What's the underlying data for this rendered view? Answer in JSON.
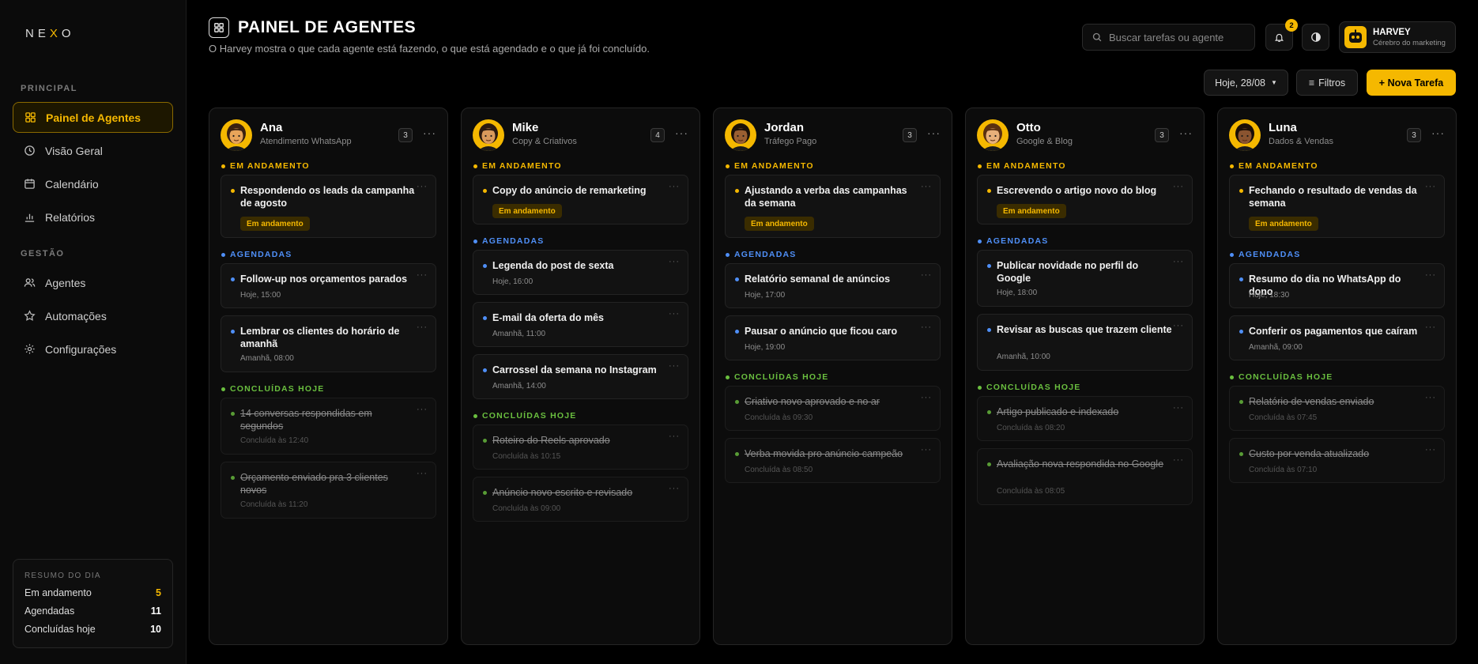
{
  "brand": {
    "logo": "NEXO"
  },
  "sidebar": {
    "sections": [
      {
        "title": "PRINCIPAL",
        "items": [
          {
            "label": "Painel de Agentes",
            "icon": "grid-icon",
            "active": true
          },
          {
            "label": "Visão Geral",
            "icon": "clock-icon"
          },
          {
            "label": "Calendário",
            "icon": "calendar-icon"
          },
          {
            "label": "Relatórios",
            "icon": "bar-chart-icon"
          }
        ]
      },
      {
        "title": "GESTÃO",
        "items": [
          {
            "label": "Agentes",
            "icon": "users-icon"
          },
          {
            "label": "Automações",
            "icon": "star-icon"
          },
          {
            "label": "Configurações",
            "icon": "gear-icon"
          }
        ]
      }
    ],
    "summary": {
      "title": "RESUMO DO DIA",
      "rows": [
        {
          "label": "Em andamento",
          "value": "5"
        },
        {
          "label": "Agendadas",
          "value": "11"
        },
        {
          "label": "Concluídas hoje",
          "value": "10"
        }
      ]
    }
  },
  "header": {
    "title": "PAINEL DE AGENTES",
    "subtitle": "O Harvey mostra o que cada agente está fazendo, o que está agendado e o que já foi concluído.",
    "search_placeholder": "Buscar tarefas ou agente",
    "notifications": "2",
    "profile": {
      "name": "HARVEY",
      "role": "Cérebro do marketing"
    },
    "date_filter": "Hoje, 28/08",
    "filters_label": "Filtros",
    "new_task_label": "+ Nova Tarefa"
  },
  "colors": {
    "accent": "#f5b800",
    "scheduled": "#4f8ff7",
    "done": "#6abf3f"
  },
  "columns": [
    {
      "name": "Ana",
      "role": "Atendimento WhatsApp",
      "count": "3",
      "skin": "#e8a45a",
      "hair": "#3a2010",
      "in_progress": {
        "label": "EM ANDAMENTO",
        "tasks": [
          {
            "title": "Respondendo os leads da campanha de agosto",
            "status": "Em andamento"
          }
        ]
      },
      "scheduled": {
        "label": "AGENDADAS",
        "tasks": [
          {
            "title": "Follow-up nos orçamentos parados",
            "time": "Hoje, 15:00"
          },
          {
            "title": "Lembrar os clientes do horário de amanhã",
            "time": "Amanhã, 08:00"
          }
        ]
      },
      "done": {
        "label": "CONCLUÍDAS HOJE",
        "tasks": [
          {
            "title": "14 conversas respondidas em segundos",
            "time": "Concluída às 12:40"
          },
          {
            "title": "Orçamento enviado pra 3 clientes novos",
            "time": "Concluída às 11:20"
          }
        ]
      }
    },
    {
      "name": "Mike",
      "role": "Copy & Criativos",
      "count": "4",
      "skin": "#d99a5c",
      "hair": "#2b1a10",
      "in_progress": {
        "label": "EM ANDAMENTO",
        "tasks": [
          {
            "title": "Copy do anúncio de remarketing",
            "status": "Em andamento"
          }
        ]
      },
      "scheduled": {
        "label": "AGENDADAS",
        "tasks": [
          {
            "title": "Legenda do post de sexta",
            "time": "Hoje, 16:00"
          },
          {
            "title": "E-mail da oferta do mês",
            "time": "Amanhã, 11:00"
          },
          {
            "title": "Carrossel da semana no Instagram",
            "time": "Amanhã, 14:00"
          }
        ]
      },
      "done": {
        "label": "CONCLUÍDAS HOJE",
        "tasks": [
          {
            "title": "Roteiro do Reels aprovado",
            "time": "Concluída às 10:15"
          },
          {
            "title": "Anúncio novo escrito e revisado",
            "time": "Concluída às 09:00"
          }
        ]
      }
    },
    {
      "name": "Jordan",
      "role": "Tráfego Pago",
      "count": "3",
      "skin": "#9a5f32",
      "hair": "#1a1008",
      "in_progress": {
        "label": "EM ANDAMENTO",
        "tasks": [
          {
            "title": "Ajustando a verba das campanhas da semana",
            "status": "Em andamento"
          }
        ]
      },
      "scheduled": {
        "label": "AGENDADAS",
        "tasks": [
          {
            "title": "Relatório semanal de anúncios",
            "time": "Hoje, 17:00"
          },
          {
            "title": "Pausar o anúncio que ficou caro",
            "time": "Hoje, 19:00"
          }
        ]
      },
      "done": {
        "label": "CONCLUÍDAS HOJE",
        "tasks": [
          {
            "title": "Criativo novo aprovado e no ar",
            "time": "Concluída às 09:30"
          },
          {
            "title": "Verba movida pro anúncio campeão",
            "time": "Concluída às 08:50"
          }
        ]
      }
    },
    {
      "name": "Otto",
      "role": "Google & Blog",
      "count": "3",
      "skin": "#e8b07a",
      "hair": "#5a3010",
      "in_progress": {
        "label": "EM ANDAMENTO",
        "tasks": [
          {
            "title": "Escrevendo o artigo novo do blog",
            "status": "Em andamento"
          }
        ]
      },
      "scheduled": {
        "label": "AGENDADAS",
        "tasks": [
          {
            "title": "Publicar novidade no perfil do Google",
            "time": "Hoje, 18:00"
          },
          {
            "title": "Revisar as buscas que trazem cliente",
            "time": "Amanhã, 10:00"
          }
        ]
      },
      "done": {
        "label": "CONCLUÍDAS HOJE",
        "tasks": [
          {
            "title": "Artigo publicado e indexado",
            "time": "Concluída às 08:20"
          },
          {
            "title": "Avaliação nova respondida no Google",
            "time": "Concluída às 08:05"
          }
        ]
      }
    },
    {
      "name": "Luna",
      "role": "Dados & Vendas",
      "count": "3",
      "skin": "#8a5430",
      "hair": "#1a0e06",
      "in_progress": {
        "label": "EM ANDAMENTO",
        "tasks": [
          {
            "title": "Fechando o resultado de vendas da semana",
            "status": "Em andamento"
          }
        ]
      },
      "scheduled": {
        "label": "AGENDADAS",
        "tasks": [
          {
            "title": "Resumo do dia no WhatsApp do dono",
            "time": "Hoje, 18:30"
          },
          {
            "title": "Conferir os pagamentos que caíram",
            "time": "Amanhã, 09:00"
          }
        ]
      },
      "done": {
        "label": "CONCLUÍDAS HOJE",
        "tasks": [
          {
            "title": "Relatório de vendas enviado",
            "time": "Concluída às 07:45"
          },
          {
            "title": "Custo por venda atualizado",
            "time": "Concluída às 07:10"
          }
        ]
      }
    }
  ]
}
